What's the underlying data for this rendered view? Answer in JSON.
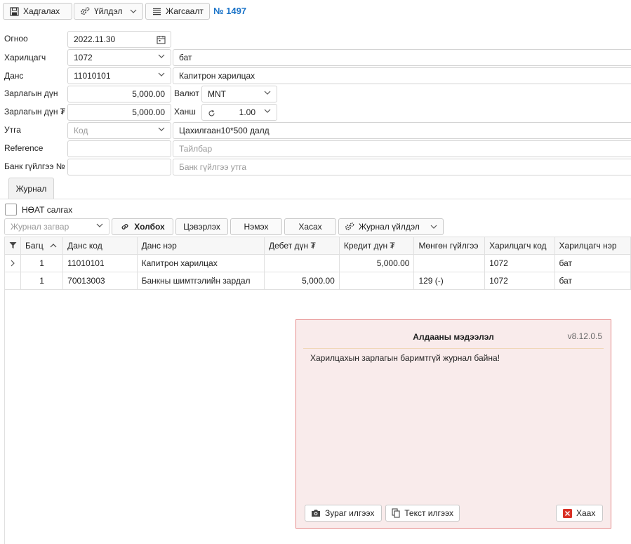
{
  "toolbar": {
    "save_label": "Хадгалах",
    "actions_label": "Үйлдэл",
    "list_label": "Жагсаалт",
    "doc_number": "№ 1497"
  },
  "form": {
    "date_label": "Огноо",
    "date_value": "2022.11.30",
    "partner_label": "Харилцагч",
    "partner_code": "1072",
    "partner_name": "бат",
    "account_label": "Данс",
    "account_code": "11010101",
    "account_name": "Капитрон харилцах",
    "amount_label": "Зарлагын дүн",
    "amount_value": "5,000.00",
    "currency_label": "Валют",
    "currency_value": "MNT",
    "amount_mnt_label": "Зарлагын дүн ₮",
    "amount_mnt_value": "5,000.00",
    "rate_label": "Ханш",
    "rate_value": "1.00",
    "purpose_label": "Утга",
    "purpose_code_placeholder": "Код",
    "purpose_text": "Цахилгаан10*500 далд",
    "reference_label": "Reference",
    "reference_value": "",
    "description_placeholder": "Тайлбар",
    "bank_tx_label": "Банк гүйлгээ №",
    "bank_tx_value": "",
    "bank_tx_desc_placeholder": "Банк гүйлгээ утга"
  },
  "journal": {
    "tab_label": "Журнал",
    "vat_checkbox_label": "НӨАТ салгах",
    "vat_checked": false,
    "template_placeholder": "Журнал загвар",
    "link_label": "Холбох",
    "clear_label": "Цэвэрлэх",
    "add_label": "Нэмэх",
    "remove_label": "Хасах",
    "journal_action_label": "Журнал үйлдэл",
    "columns": [
      "Багц",
      "Данс код",
      "Данс нэр",
      "Дебет дүн ₮",
      "Кредит дүн ₮",
      "Мөнгөн гүйлгээ",
      "Харилцагч код",
      "Харилцагч нэр"
    ],
    "rows": [
      {
        "batch": "1",
        "account_code": "11010101",
        "account_name": "Капитрон харилцах",
        "debit": "",
        "credit": "5,000.00",
        "cash_flow": "",
        "partner_code": "1072",
        "partner_name": "бат"
      },
      {
        "batch": "1",
        "account_code": "70013003",
        "account_name": "Банкны шимтгэлийн зардал",
        "debit": "5,000.00",
        "credit": "",
        "cash_flow": "129 (-)",
        "partner_code": "1072",
        "partner_name": "бат"
      }
    ]
  },
  "error_dialog": {
    "title": "Алдааны мэдээлэл",
    "version": "v8.12.0.5",
    "message": "Харилцахын зарлагын баримтгүй журнал байна!",
    "send_image_label": "Зураг илгээх",
    "send_text_label": "Текст илгээх",
    "close_label": "Хаах"
  },
  "colors": {
    "accent": "#1a73c8",
    "dialog_bg": "#f9ebeb",
    "dialog_border": "#e58a8a",
    "close_icon": "#d93025"
  },
  "icons": {
    "save": "save-icon",
    "actions": "gears-icon",
    "list": "list-icon",
    "calendar": "calendar-icon",
    "refresh": "refresh-icon",
    "link": "link-icon",
    "filter": "filter-icon",
    "sort_asc": "sort-up-icon",
    "row_expand": "chevron-right-icon",
    "camera": "camera-icon",
    "copy": "copy-icon",
    "close": "close-icon"
  }
}
